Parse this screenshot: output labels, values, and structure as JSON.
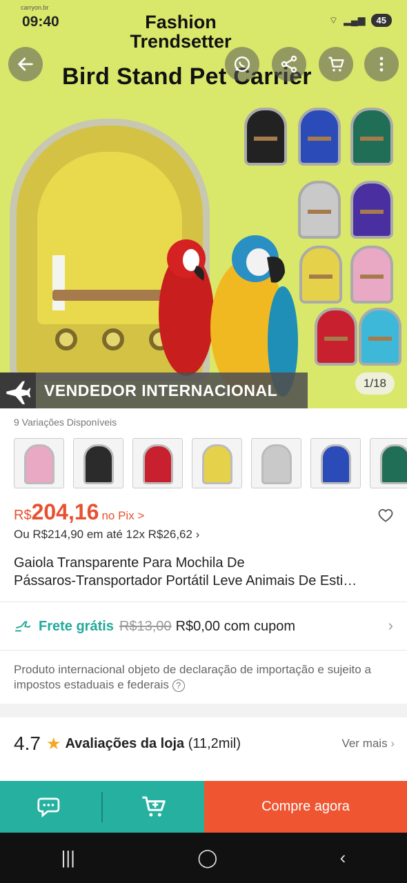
{
  "status": {
    "time": "09:40",
    "carrier_tag": "carryon.br",
    "battery": "45"
  },
  "hero": {
    "title_line1": "Fashion",
    "title_line2": "Trendsetter",
    "title_main": "Bird Stand Pet Carrier",
    "badge": "VENDEDOR INTERNACIONAL",
    "counter": "1/18"
  },
  "variations": {
    "label": "9 Variações Disponíveis",
    "colors": [
      "#e9a8c3",
      "#2b2b2b",
      "#c8202e",
      "#e6d14a",
      "#c9c9c9",
      "#2a4bb8",
      "#1f6e55"
    ]
  },
  "price": {
    "currency": "R$",
    "value": "204,16",
    "pix": "no Pix >",
    "installments": "Ou R$214,90 em até 12x R$26,62 ›"
  },
  "product": {
    "title_line1": "Gaiola Transparente Para Mochila De",
    "title_line2": "Pássaros-Transportador Portátil Leve Animais De Esti…"
  },
  "shipping": {
    "free": "Frete grátis",
    "old_price": "R$13,00",
    "new_price": "R$0,00 com cupom"
  },
  "notice": "Produto internacional objeto de declaração de importação e sujeito a impostos estaduais e federais",
  "rating": {
    "score": "4.7",
    "label": "Avaliações da loja",
    "count": "(11,2mil)",
    "more": "Ver mais"
  },
  "bottom": {
    "buy": "Compre agora"
  },
  "colors": {
    "accent_teal": "#26b0a0",
    "accent_orange": "#ee5530",
    "price_red": "#e8502f"
  }
}
